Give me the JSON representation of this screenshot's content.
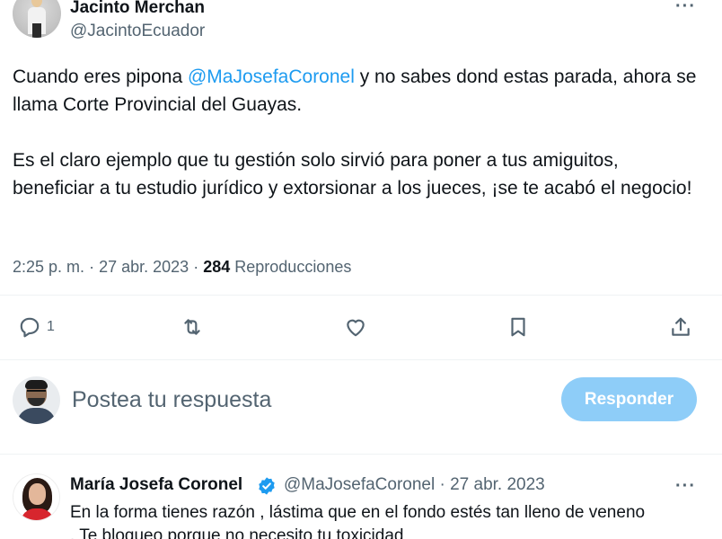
{
  "tweet": {
    "author_name": "Jacinto Merchan",
    "author_handle": "@JacintoEcuador",
    "more_label": "···",
    "text_part1": "Cuando eres pipona ",
    "mention": "@MaJosefaCoronel",
    "text_part2": " y no sabes dond estas parada, ahora se llama Corte Provincial del Guayas.",
    "paragraph2": "Es el claro ejemplo que tu gestión solo sirvió para poner a tus amiguitos, beneficiar a tu estudio jurídico y extorsionar a los jueces, ¡se te acabó el negocio!",
    "time": "2:25 p. m.",
    "date": "27 abr. 2023",
    "views_count": "284",
    "views_label": "Reproducciones",
    "separator": "·"
  },
  "actions": {
    "reply_count": "1",
    "icons": [
      "reply-icon",
      "retweet-icon",
      "like-icon",
      "bookmark-icon",
      "share-icon"
    ]
  },
  "composer": {
    "placeholder": "Postea tu respuesta",
    "button_label": "Responder",
    "button_color": "#8ecdf8"
  },
  "reply": {
    "author_name": "María Josefa Coronel",
    "author_handle": "@MaJosefaCoronel",
    "separator": "·",
    "date": "27 abr. 2023",
    "more_label": "···",
    "text_line1": "En la forma tienes razón , lástima que en el fondo estés tan lleno de veneno",
    "text_line2": ". Te bloqueo porque no necesito tu toxicidad"
  },
  "colors": {
    "accent": "#1d9bf0",
    "secondary_text": "#536471",
    "primary_text": "#0f1419"
  }
}
